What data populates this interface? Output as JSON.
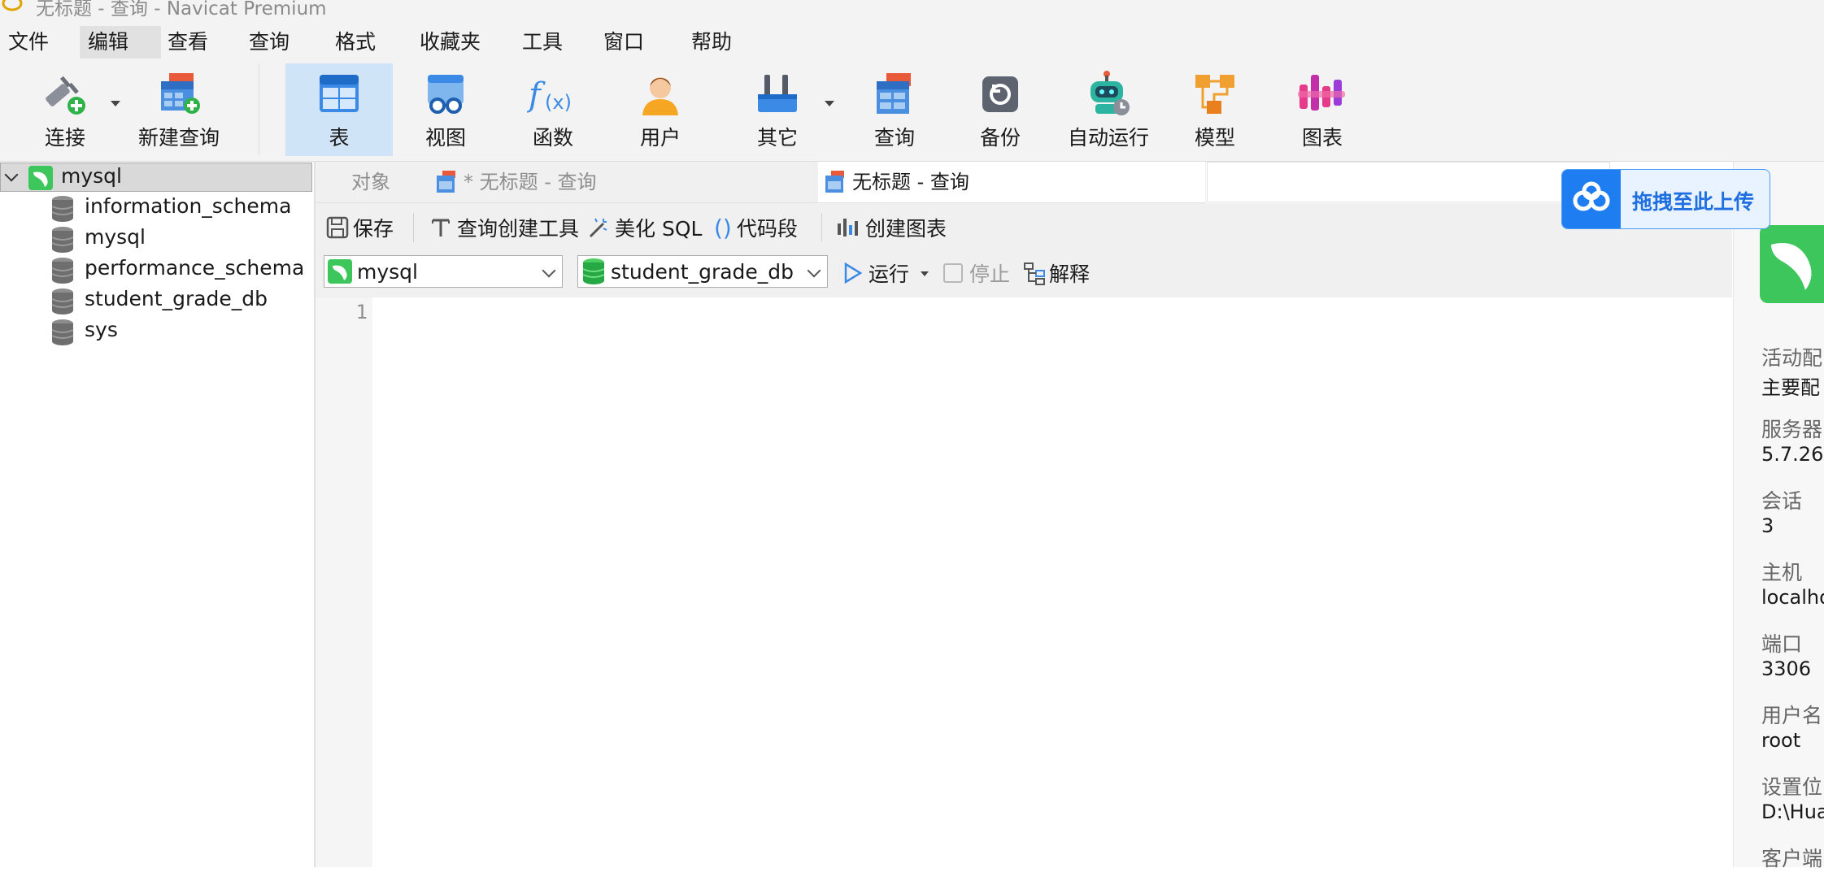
{
  "window": {
    "title": "无标题 - 查询 - Navicat Premium"
  },
  "menu": [
    "文件",
    "编辑",
    "查看",
    "查询",
    "格式",
    "收藏夹",
    "工具",
    "窗口",
    "帮助"
  ],
  "toolbar": {
    "connect": "连接",
    "new_query": "新建查询",
    "table": "表",
    "view": "视图",
    "function": "函数",
    "user": "用户",
    "other": "其它",
    "query": "查询",
    "backup": "备份",
    "automation": "自动运行",
    "model": "模型",
    "chart": "图表"
  },
  "tree": {
    "connection": "mysql",
    "databases": [
      "information_schema",
      "mysql",
      "performance_schema",
      "student_grade_db",
      "sys"
    ]
  },
  "tabs": {
    "objects": "对象",
    "query1": "* 无标题 - 查询",
    "query2": "无标题 - 查询"
  },
  "query_toolbar": {
    "save": "保存",
    "query_builder": "查询创建工具",
    "beautify": "美化 SQL",
    "snippet": "代码段",
    "create_chart": "创建图表"
  },
  "selectors": {
    "connection": "mysql",
    "database": "student_grade_db",
    "run": "运行",
    "stop": "停止",
    "explain": "解释"
  },
  "editor": {
    "line_number": "1"
  },
  "info": {
    "items": [
      {
        "label": "活动配",
        "value": "主要配"
      },
      {
        "label": "服务器",
        "value": "5.7.26"
      },
      {
        "label": "会话",
        "value": "3"
      },
      {
        "label": "主机",
        "value": "localho"
      },
      {
        "label": "端口",
        "value": "3306"
      },
      {
        "label": "用户名",
        "value": "root"
      },
      {
        "label": "设置位",
        "value": "D:\\Hua"
      },
      {
        "label": "客户端",
        "value": ""
      }
    ]
  },
  "upload": {
    "text": "拖拽至此上传"
  },
  "colors": {
    "accent": "#1f7df2",
    "active_tab": "#cfe4f7",
    "mysql_green": "#3cc65b"
  }
}
